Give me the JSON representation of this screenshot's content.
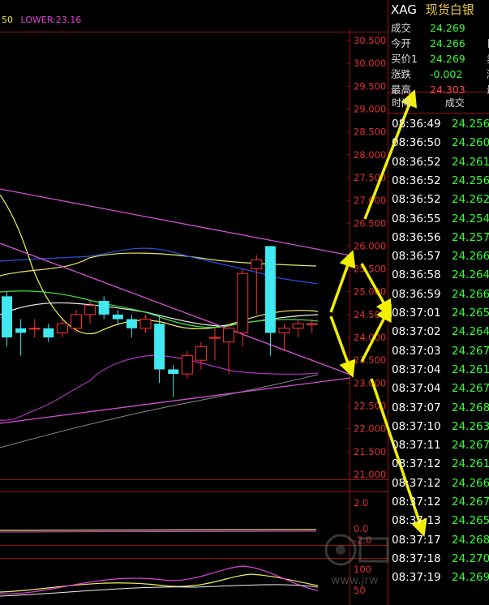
{
  "legend": {
    "left_fragment": "50",
    "lower_label": "LOWER:23.16"
  },
  "quote": {
    "code": "XAG",
    "name": "现货白银",
    "rows": [
      {
        "label": "成交",
        "value": "24.269",
        "cut": "",
        "color": "#33ff33"
      },
      {
        "label": "今开",
        "value": "24.266",
        "cut": "日",
        "color": "#33ff33"
      },
      {
        "label": "买价1",
        "value": "24.269",
        "cut": "卖",
        "color": "#33ff33"
      },
      {
        "label": "涨跌",
        "value": "-0.002",
        "cut": "涨",
        "color": "#33ff33"
      },
      {
        "label": "最高",
        "value": "24.303",
        "cut": "最",
        "color": "#ff4040"
      }
    ]
  },
  "ticks_header": {
    "time": "时间",
    "deal": "成交"
  },
  "ticks": [
    {
      "time": "08:36:49",
      "price": "24.256"
    },
    {
      "time": "08:36:50",
      "price": "24.260"
    },
    {
      "time": "08:36:52",
      "price": "24.261"
    },
    {
      "time": "08:36:52",
      "price": "24.256"
    },
    {
      "time": "08:36:52",
      "price": "24.262"
    },
    {
      "time": "08:36:55",
      "price": "24.254"
    },
    {
      "time": "08:36:56",
      "price": "24.257"
    },
    {
      "time": "08:36:57",
      "price": "24.266"
    },
    {
      "time": "08:36:58",
      "price": "24.264"
    },
    {
      "time": "08:36:59",
      "price": "24.266"
    },
    {
      "time": "08:37:01",
      "price": "24.265"
    },
    {
      "time": "08:37:02",
      "price": "24.264"
    },
    {
      "time": "08:37:03",
      "price": "24.267"
    },
    {
      "time": "08:37:04",
      "price": "24.261"
    },
    {
      "time": "08:37:04",
      "price": "24.267"
    },
    {
      "time": "08:37:07",
      "price": "24.268"
    },
    {
      "time": "08:37:10",
      "price": "24.263"
    },
    {
      "time": "08:37:11",
      "price": "24.267"
    },
    {
      "time": "08:37:12",
      "price": "24.261"
    },
    {
      "time": "08:37:12",
      "price": "24.266"
    },
    {
      "time": "08:37:12",
      "price": "24.267"
    },
    {
      "time": "08:37:13",
      "price": "24.265"
    },
    {
      "time": "08:37:17",
      "price": "24.268"
    },
    {
      "time": "08:37:18",
      "price": "24.270"
    },
    {
      "time": "08:37:19",
      "price": "24.269"
    }
  ],
  "chart_data": {
    "type": "candlestick",
    "price_ticks": [
      "30.500",
      "30.000",
      "29.500",
      "29.000",
      "28.500",
      "28.000",
      "27.500",
      "27.000",
      "26.500",
      "26.000",
      "25.500",
      "25.000",
      "24.500",
      "24.000",
      "23.500",
      "23.000",
      "22.500",
      "22.000",
      "21.500",
      "21.000"
    ],
    "macd_ticks": [
      "2.0",
      "0.0",
      "-2.0"
    ],
    "kdj_ticks": [
      "100",
      "50"
    ],
    "candles": [
      {
        "o": 24.9,
        "c": 24.0,
        "h": 25.0,
        "l": 23.8
      },
      {
        "o": 24.2,
        "c": 24.1,
        "h": 24.4,
        "l": 23.6
      },
      {
        "o": 24.2,
        "c": 24.2,
        "h": 24.4,
        "l": 24.0
      },
      {
        "o": 24.2,
        "c": 24.0,
        "h": 24.3,
        "l": 23.9
      },
      {
        "o": 24.1,
        "c": 24.3,
        "h": 24.4,
        "l": 24.0
      },
      {
        "o": 24.2,
        "c": 24.5,
        "h": 24.6,
        "l": 24.1
      },
      {
        "o": 24.5,
        "c": 24.7,
        "h": 24.8,
        "l": 24.3
      },
      {
        "o": 24.8,
        "c": 24.5,
        "h": 24.9,
        "l": 24.4
      },
      {
        "o": 24.5,
        "c": 24.4,
        "h": 24.6,
        "l": 24.3
      },
      {
        "o": 24.4,
        "c": 24.2,
        "h": 24.5,
        "l": 24.0
      },
      {
        "o": 24.2,
        "c": 24.4,
        "h": 24.5,
        "l": 24.1
      },
      {
        "o": 24.3,
        "c": 23.3,
        "h": 24.5,
        "l": 23.0
      },
      {
        "o": 23.3,
        "c": 23.2,
        "h": 23.4,
        "l": 22.7
      },
      {
        "o": 23.2,
        "c": 23.6,
        "h": 23.7,
        "l": 23.1
      },
      {
        "o": 23.5,
        "c": 23.8,
        "h": 23.9,
        "l": 23.3
      },
      {
        "o": 24.0,
        "c": 24.0,
        "h": 24.2,
        "l": 23.5
      },
      {
        "o": 23.9,
        "c": 24.2,
        "h": 24.3,
        "l": 23.2
      },
      {
        "o": 24.1,
        "c": 25.4,
        "h": 25.5,
        "l": 23.8
      },
      {
        "o": 25.5,
        "c": 25.7,
        "h": 25.8,
        "l": 24.5
      },
      {
        "o": 26.0,
        "c": 24.1,
        "h": 26.0,
        "l": 23.6
      },
      {
        "o": 24.1,
        "c": 24.2,
        "h": 24.3,
        "l": 23.7
      },
      {
        "o": 24.2,
        "c": 24.3,
        "h": 24.4,
        "l": 24.0
      },
      {
        "o": 24.3,
        "c": 24.3,
        "h": 24.4,
        "l": 24.1
      }
    ]
  },
  "colors": {
    "up": "#ff3030",
    "down": "#40e8f0",
    "grid": "#9a1010",
    "axis_text": "#e03030",
    "upper_band": "#e8e860",
    "mid_band": "#2850e0",
    "lower_band": "#b030c0",
    "arrow": "#f0f000",
    "trend": "#d050d0"
  }
}
